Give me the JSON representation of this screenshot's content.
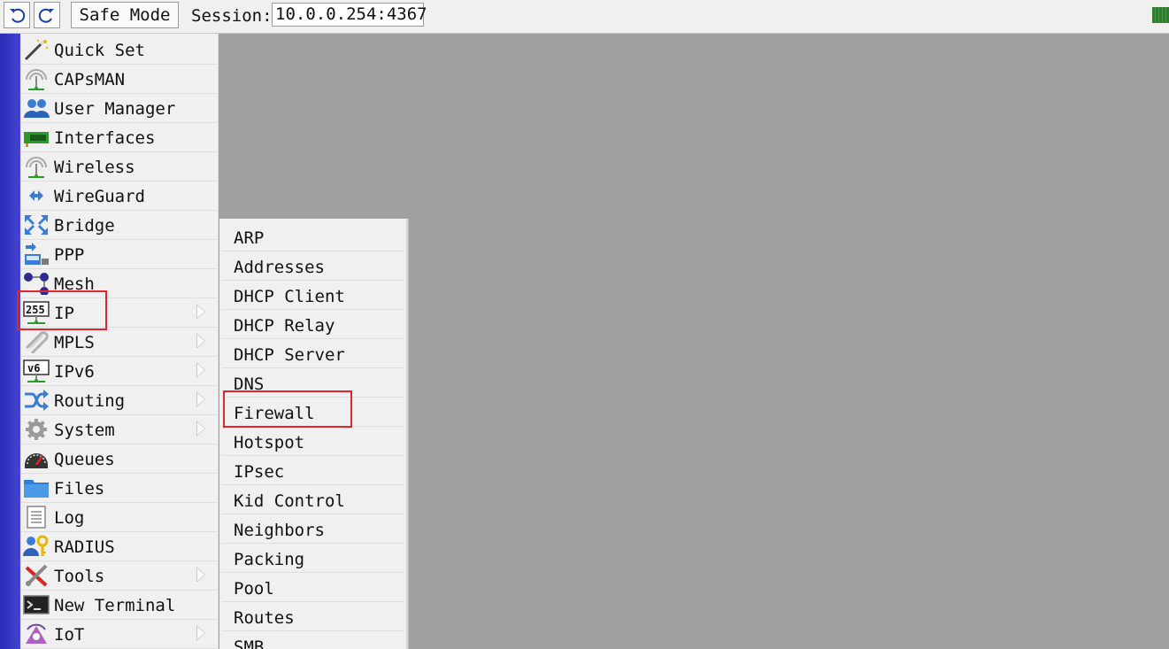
{
  "toolbar": {
    "undo_icon": "undo-icon",
    "redo_icon": "redo-icon",
    "safe_mode_label": "Safe Mode",
    "session_label": "Session:",
    "session_value": "10.0.0.254:4367",
    "status_color": "#2f7d2f"
  },
  "menu": {
    "items": [
      {
        "label": "Quick Set",
        "icon": "wand-icon",
        "submenu": false
      },
      {
        "label": "CAPsMAN",
        "icon": "antenna-icon",
        "submenu": false
      },
      {
        "label": "User Manager",
        "icon": "users-icon",
        "submenu": false
      },
      {
        "label": "Interfaces",
        "icon": "network-card-icon",
        "submenu": false
      },
      {
        "label": "Wireless",
        "icon": "antenna-icon",
        "submenu": false
      },
      {
        "label": "WireGuard",
        "icon": "wireguard-icon",
        "submenu": false
      },
      {
        "label": "Bridge",
        "icon": "bridge-icon",
        "submenu": false
      },
      {
        "label": "PPP",
        "icon": "ppp-icon",
        "submenu": false
      },
      {
        "label": "Mesh",
        "icon": "mesh-icon",
        "submenu": false
      },
      {
        "label": "IP",
        "icon": "ip-icon",
        "submenu": true
      },
      {
        "label": "MPLS",
        "icon": "mpls-icon",
        "submenu": true
      },
      {
        "label": "IPv6",
        "icon": "ipv6-icon",
        "submenu": true
      },
      {
        "label": "Routing",
        "icon": "routing-icon",
        "submenu": true
      },
      {
        "label": "System",
        "icon": "gear-icon",
        "submenu": true
      },
      {
        "label": "Queues",
        "icon": "gauge-icon",
        "submenu": false
      },
      {
        "label": "Files",
        "icon": "folder-icon",
        "submenu": false
      },
      {
        "label": "Log",
        "icon": "log-icon",
        "submenu": false
      },
      {
        "label": "RADIUS",
        "icon": "radius-icon",
        "submenu": false
      },
      {
        "label": "Tools",
        "icon": "tools-icon",
        "submenu": true
      },
      {
        "label": "New Terminal",
        "icon": "terminal-icon",
        "submenu": false
      },
      {
        "label": "IoT",
        "icon": "iot-icon",
        "submenu": true
      }
    ]
  },
  "ip_submenu": {
    "items": [
      "ARP",
      "Addresses",
      "DHCP Client",
      "DHCP Relay",
      "DHCP Server",
      "DNS",
      "Firewall",
      "Hotspot",
      "IPsec",
      "Kid Control",
      "Neighbors",
      "Packing",
      "Pool",
      "Routes",
      "SMB"
    ]
  },
  "highlights": [
    "IP",
    "Firewall"
  ],
  "colors": {
    "workspace": "#a0a0a0",
    "menu_background": "#f0f0f0",
    "side_strip": "#3333c0",
    "highlight_border": "#e0262b"
  }
}
